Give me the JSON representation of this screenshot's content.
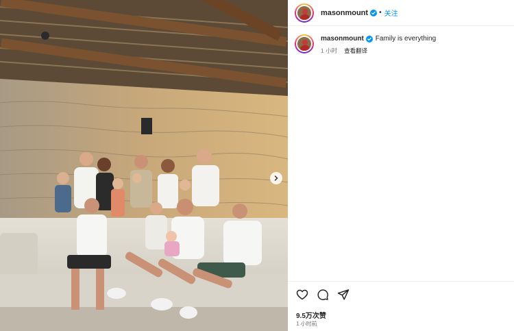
{
  "post": {
    "author": "masonmount",
    "separator": "•",
    "follow_label": "关注",
    "caption": "Family is everything",
    "caption_time": "1 小时",
    "translate_label": "查看翻译",
    "views": "9.5万次赞",
    "post_time": "1 小时前"
  },
  "icons": {
    "verified": "verified-badge-icon",
    "like": "heart-icon",
    "comment": "comment-icon",
    "share": "share-icon",
    "next": "chevron-right-icon"
  },
  "colors": {
    "accent": "#0095f6",
    "verified": "#0095f6",
    "muted": "#737373"
  }
}
